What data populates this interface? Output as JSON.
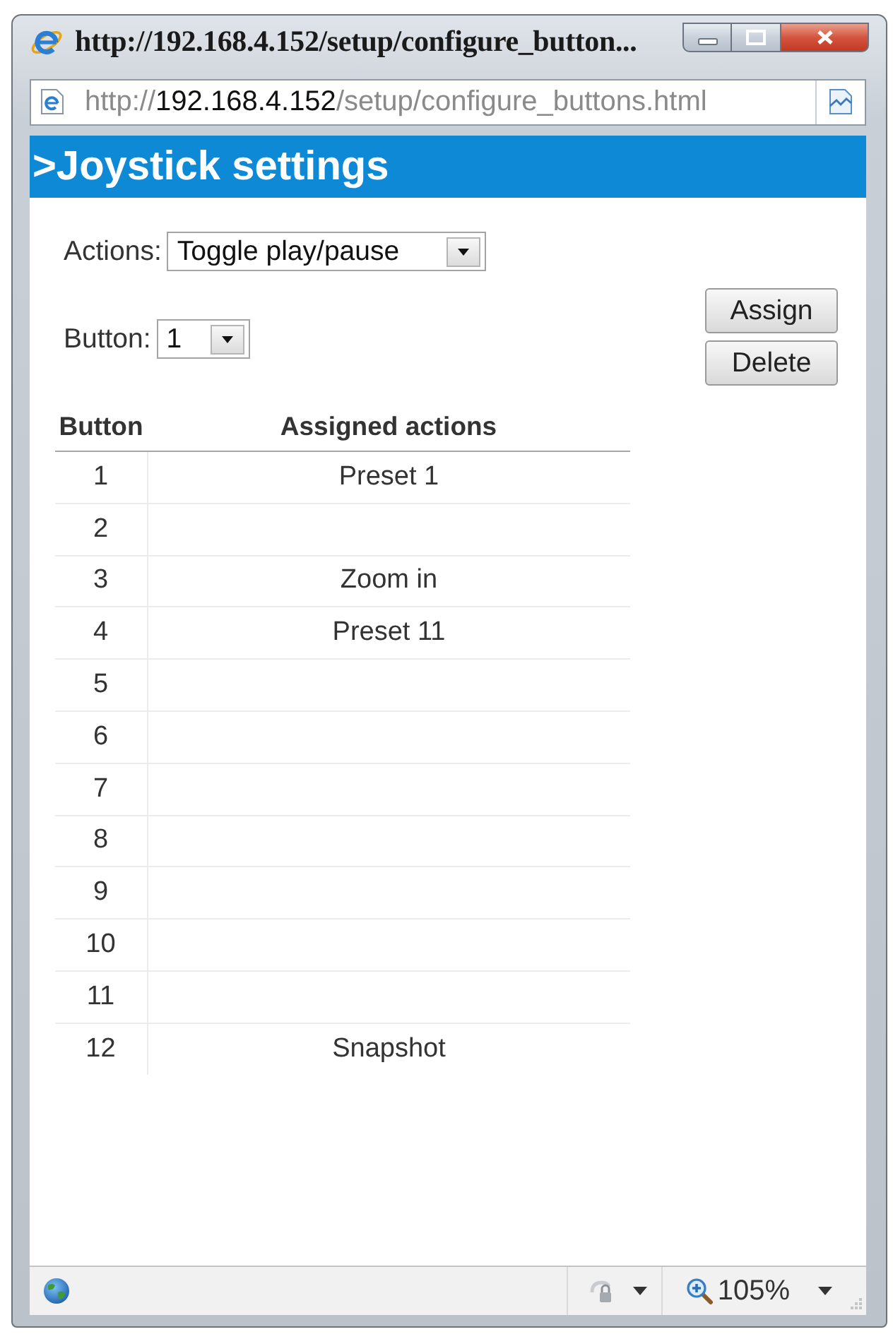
{
  "window": {
    "title": "http://192.168.4.152/setup/configure_button..."
  },
  "address_bar": {
    "url_prefix": "http://",
    "url_host": "192.168.4.152",
    "url_path": "/setup/configure_buttons.html"
  },
  "page": {
    "heading": ">Joystick settings",
    "actions_field": {
      "label": "Actions:",
      "value": "Toggle play/pause"
    },
    "button_field": {
      "label": "Button:",
      "value": "1"
    },
    "buttons": [
      "Assign",
      "Delete"
    ],
    "table": {
      "columns": [
        "Button",
        "Assigned actions"
      ],
      "rows": [
        {
          "button": "1",
          "action": "Preset 1"
        },
        {
          "button": "2"
        },
        {
          "button": "3",
          "action": "Zoom in"
        },
        {
          "button": "4",
          "action": "Preset 11"
        },
        {
          "button": "5"
        },
        {
          "button": "6"
        },
        {
          "button": "7"
        },
        {
          "button": "8"
        },
        {
          "button": "9"
        },
        {
          "button": "10"
        },
        {
          "button": "11"
        },
        {
          "button": "12",
          "action": "Snapshot"
        }
      ]
    }
  },
  "status_bar": {
    "zoom": "105%"
  }
}
